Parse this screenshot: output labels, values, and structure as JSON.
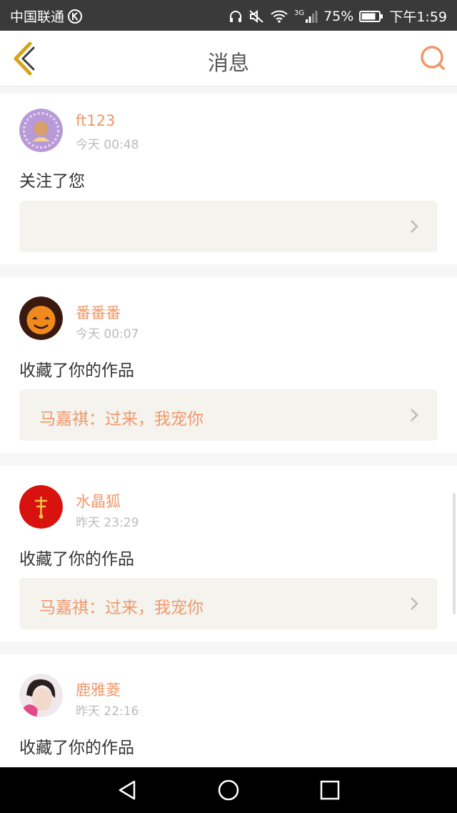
{
  "status_bar": {
    "carrier": "中国联通",
    "network": "3G",
    "battery": "75%",
    "time": "下午1:59"
  },
  "header": {
    "title": "消息"
  },
  "messages": [
    {
      "username": "ft123",
      "time": "今天 00:48",
      "action": "关注了您",
      "ref": ""
    },
    {
      "username": "番番番",
      "time": "今天 00:07",
      "action": "收藏了你的作品",
      "ref": "马嘉祺：过来，我宠你"
    },
    {
      "username": "水晶狐",
      "time": "昨天 23:29",
      "action": "收藏了你的作品",
      "ref": "马嘉祺：过来，我宠你"
    },
    {
      "username": "鹿雅菱",
      "time": "昨天 22:16",
      "action": "收藏了你的作品"
    }
  ],
  "colors": {
    "accent": "#f0986a",
    "back_arrow": "#d9a21b",
    "ref_bg": "#f4f3ee"
  }
}
